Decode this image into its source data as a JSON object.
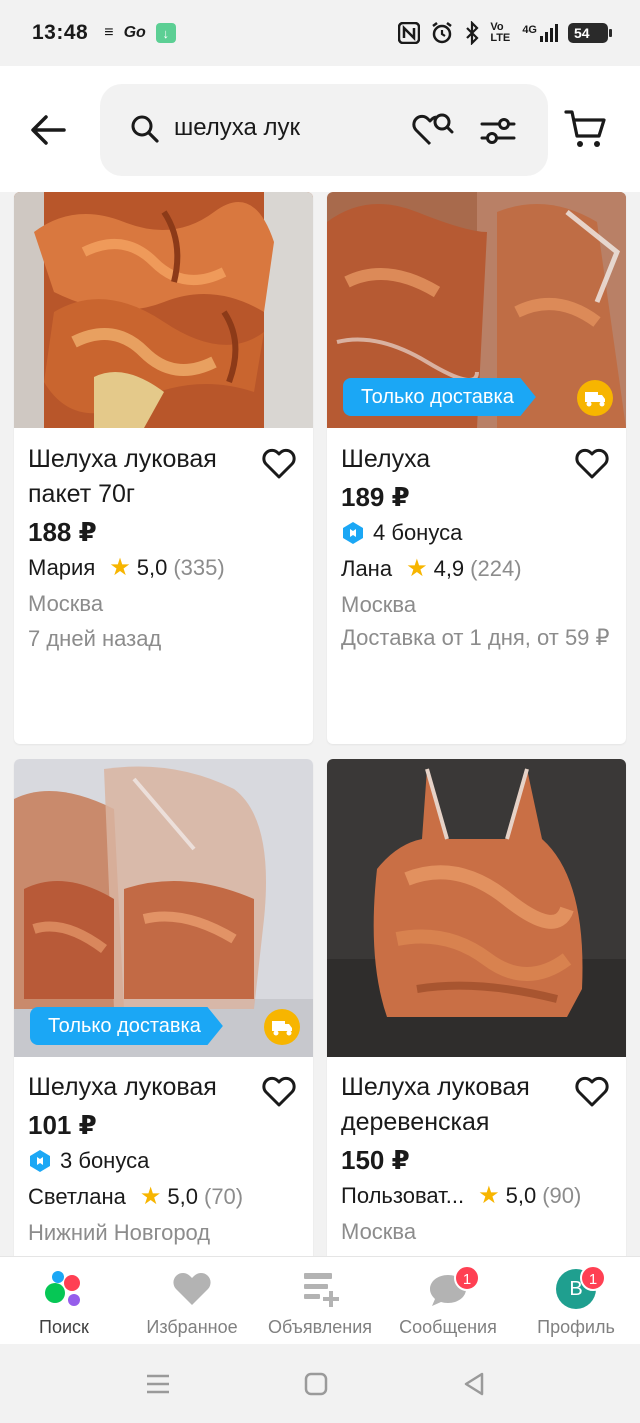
{
  "status_bar": {
    "time": "13:48",
    "left_icons": [
      "notes-icon",
      "go-icon",
      "download-icon"
    ],
    "right_icons": [
      "nfc-icon",
      "alarm-icon",
      "bluetooth-icon",
      "volte-icon",
      "signal-4g-icon",
      "battery-icon"
    ],
    "volte": "Vo LTE",
    "network": "4G",
    "battery": "54"
  },
  "header": {
    "search_value": "шелуха лук",
    "icons": [
      "back-arrow-icon",
      "search-icon",
      "heart-search-icon",
      "filter-icon",
      "cart-icon"
    ]
  },
  "listings": [
    {
      "title": "Шелуха луковая пакет 70г",
      "price": "188 ₽",
      "seller": "Мария",
      "rating": "5,0",
      "reviews": "(335)",
      "city": "Москва",
      "date": "7 дней назад"
    },
    {
      "title": "Шелуха",
      "price": "189 ₽",
      "badge": "Только доставка",
      "bonus": "4 бонуса",
      "seller": "Лана",
      "rating": "4,9",
      "reviews": "(224)",
      "city": "Москва",
      "delivery": "Доставка от 1 дня, от 59 ₽"
    },
    {
      "title": "Шелуха луковая",
      "price": "101 ₽",
      "badge": "Только доставка",
      "bonus": "3 бонуса",
      "seller": "Светлана",
      "rating": "5,0",
      "reviews": "(70)",
      "city": "Нижний Новгород"
    },
    {
      "title": "Шелуха луковая деревенская",
      "price": "150 ₽",
      "seller": "Пользоват...",
      "rating": "5,0",
      "reviews": "(90)",
      "city": "Москва"
    }
  ],
  "bottom_nav": [
    {
      "label": "Поиск",
      "icon": "search-dots-icon",
      "active": true
    },
    {
      "label": "Избранное",
      "icon": "heart-icon"
    },
    {
      "label": "Объявления",
      "icon": "listings-add-icon"
    },
    {
      "label": "Сообщения",
      "icon": "chat-icon",
      "badge": "1"
    },
    {
      "label": "Профиль",
      "icon": "avatar-icon",
      "avatar_letter": "В",
      "badge": "1"
    }
  ],
  "system_nav": [
    "menu-icon",
    "home-icon",
    "back-icon"
  ],
  "colors": {
    "accent_blue": "#1ba7f5",
    "star": "#f7b500",
    "badge_red": "#ff4053",
    "secondary_text": "#8c8c8c"
  }
}
